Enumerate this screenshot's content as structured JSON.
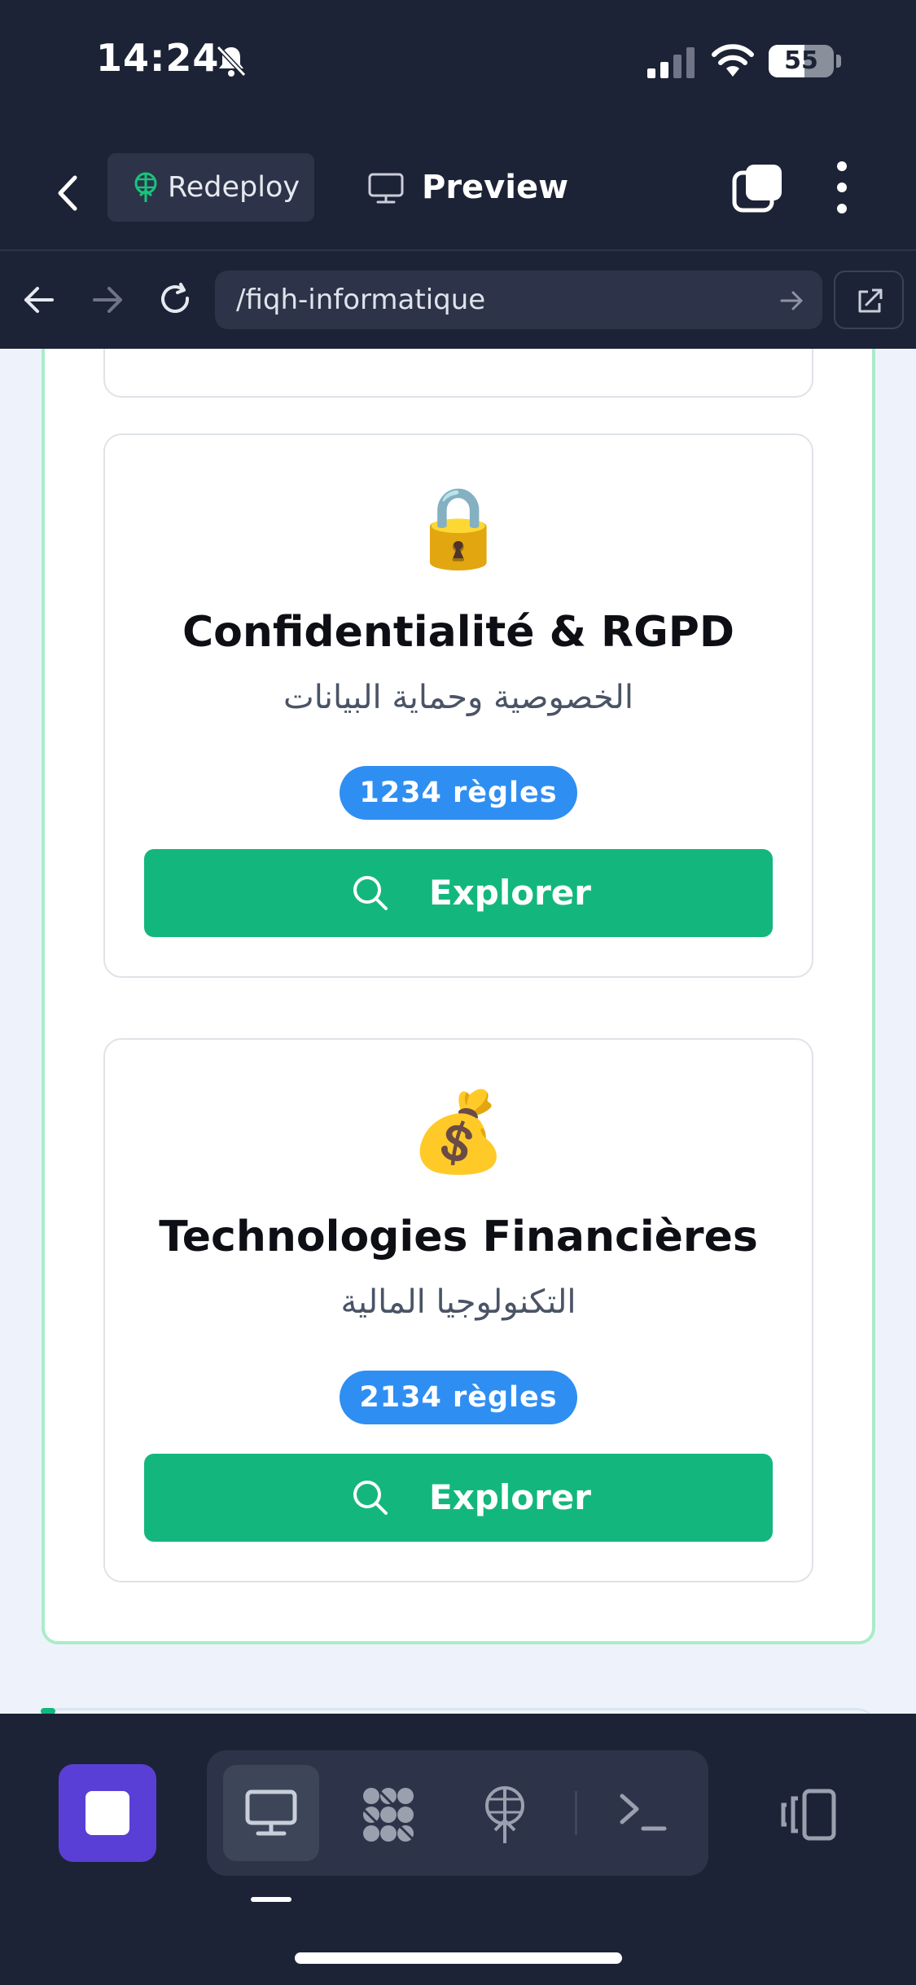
{
  "status_bar": {
    "time": "14:24",
    "battery": "55",
    "battery_level": 0.55
  },
  "header": {
    "redeploy_label": "Redeploy",
    "preview_label": "Preview"
  },
  "browser": {
    "url": "/fiqh-informatique"
  },
  "cards": [
    {
      "emoji": "🔒",
      "title": "Confidentialité & RGPD",
      "subtitle": "الخصوصية وحماية البيانات",
      "badge": "1234 règles",
      "button_label": "Explorer"
    },
    {
      "emoji": "💰",
      "title": "Technologies Financières",
      "subtitle": "التكنولوجيا المالية",
      "badge": "2134 règles",
      "button_label": "Explorer"
    }
  ],
  "colors": {
    "accent_green": "#13b77d",
    "badge_blue": "#2f8ef2",
    "stop_purple": "#5a3fd6",
    "chrome_dark": "#1d2336"
  },
  "icons": [
    "bell-slash-icon",
    "signal-icon",
    "wifi-icon",
    "back-icon",
    "redeploy-icon",
    "monitor-icon",
    "tabs-icon",
    "more-icon",
    "arrow-left-icon",
    "arrow-right-icon",
    "reload-icon",
    "open-external-icon",
    "search-icon",
    "stop-icon",
    "desktop-icon",
    "nodes-icon",
    "deploy-icon",
    "terminal-icon",
    "devices-icon"
  ]
}
